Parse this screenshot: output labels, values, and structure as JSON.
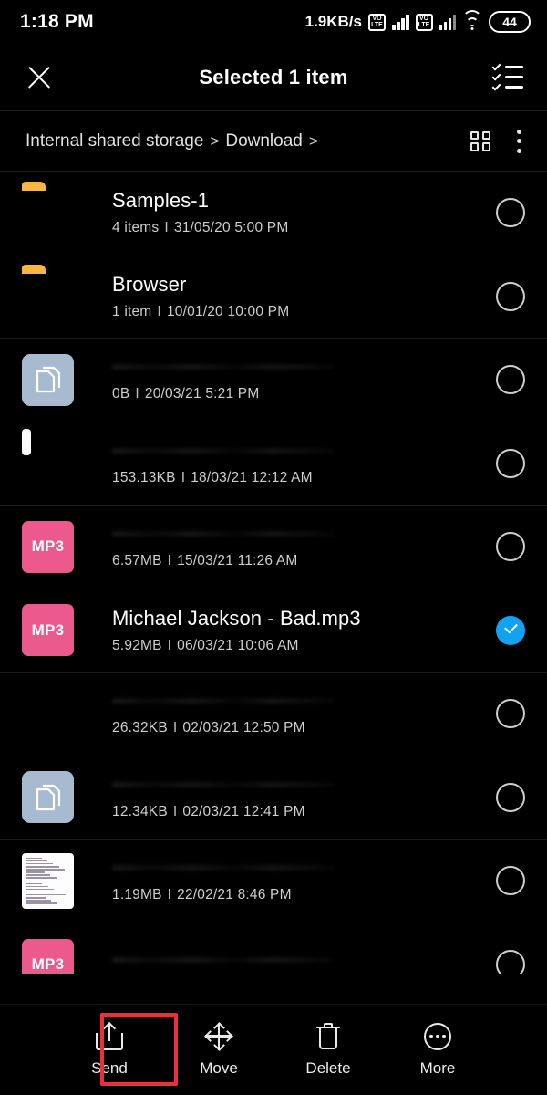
{
  "status_bar": {
    "time": "1:18 PM",
    "network_speed": "1.9KB/s",
    "volte_label_top": "VO",
    "volte_label_bottom": "LTE",
    "battery_level": "44"
  },
  "app_bar": {
    "close_icon": "close-icon",
    "title": "Selected 1 item",
    "select_all_icon": "select-all-icon"
  },
  "breadcrumb": {
    "root": "Internal shared storage",
    "separator": ">",
    "current": "Download",
    "trailing_separator": ">",
    "grid_view_icon": "grid-view-icon",
    "overflow_icon": "overflow-menu-icon"
  },
  "files": [
    {
      "name": "Samples-1",
      "name_visible": true,
      "size": "4 items",
      "date": "31/05/20 5:00 PM",
      "icon": "folder-icon",
      "selected": false
    },
    {
      "name": "Browser",
      "name_visible": true,
      "size": "1 item",
      "date": "10/01/20 10:00 PM",
      "icon": "folder-icon",
      "selected": false
    },
    {
      "name": "",
      "name_visible": false,
      "size": "0B",
      "date": "20/03/21 5:21 PM",
      "icon": "document-icon",
      "selected": false
    },
    {
      "name": "",
      "name_visible": false,
      "size": "153.13KB",
      "date": "18/03/21 12:12 AM",
      "icon": "certificate-thumbnail",
      "selected": false
    },
    {
      "name": "",
      "name_visible": false,
      "size": "6.57MB",
      "date": "15/03/21 11:26 AM",
      "icon": "mp3-icon",
      "selected": false
    },
    {
      "name": "Michael Jackson - Bad.mp3",
      "name_visible": true,
      "size": "5.92MB",
      "date": "06/03/21 10:06 AM",
      "icon": "mp3-icon",
      "selected": true
    },
    {
      "name": "",
      "name_visible": false,
      "size": "26.32KB",
      "date": "02/03/21 12:50 PM",
      "icon": "photo-thumbnail",
      "selected": false
    },
    {
      "name": "",
      "name_visible": false,
      "size": "12.34KB",
      "date": "02/03/21 12:41 PM",
      "icon": "document-icon",
      "selected": false
    },
    {
      "name": "",
      "name_visible": false,
      "size": "1.19MB",
      "date": "22/02/21 8:46 PM",
      "icon": "spreadsheet-thumbnail",
      "selected": false
    },
    {
      "name": "",
      "name_visible": false,
      "size": "",
      "date": "",
      "icon": "mp3-icon",
      "selected": false
    }
  ],
  "meta_separator": "I",
  "mp3_badge_label": "MP3",
  "action_bar": {
    "actions": [
      {
        "label": "Send",
        "icon": "share-icon"
      },
      {
        "label": "Move",
        "icon": "move-arrows-icon"
      },
      {
        "label": "Delete",
        "icon": "trash-icon"
      },
      {
        "label": "More",
        "icon": "more-ellipsis-icon"
      }
    ]
  },
  "annotation": {
    "highlight_color": "#E8313C",
    "target": "Send"
  }
}
